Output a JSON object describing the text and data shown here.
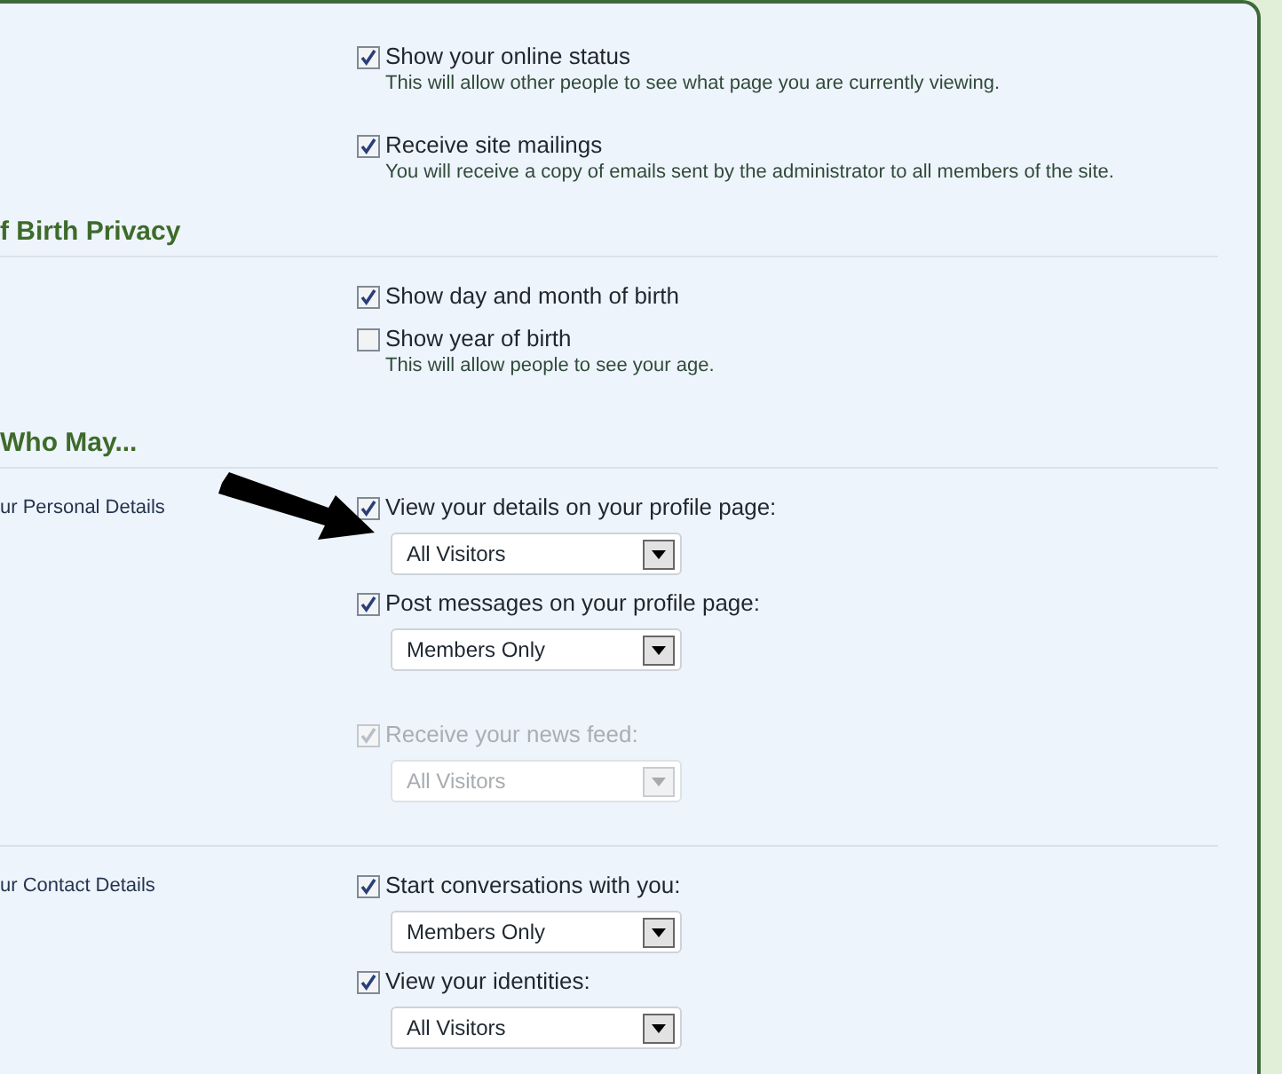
{
  "top_options": [
    {
      "label": "Show your online status",
      "checked": true,
      "description": "This will allow other people to see what page you are currently viewing."
    },
    {
      "label": "Receive site mailings",
      "checked": true,
      "description": "You will receive a copy of emails sent by the administrator to all members of the site."
    }
  ],
  "sections": [
    {
      "heading": "f Birth Privacy",
      "groups": [
        {
          "items": [
            {
              "kind": "checkbox",
              "label": "Show day and month of birth",
              "checked": true,
              "disabled": false
            },
            {
              "kind": "checkbox",
              "label": "Show year of birth",
              "checked": false,
              "disabled": false,
              "description": "This will allow people to see your age."
            }
          ]
        }
      ]
    },
    {
      "heading": "Who May...",
      "groups": [
        {
          "label": "ur Personal Details",
          "items": [
            {
              "kind": "select",
              "label": "View your details on your profile page:",
              "checked": true,
              "disabled": false,
              "value": "All Visitors"
            },
            {
              "kind": "select",
              "label": "Post messages on your profile page:",
              "checked": true,
              "disabled": false,
              "value": "Members Only"
            },
            {
              "kind": "select",
              "label": "Receive your news feed:",
              "checked": true,
              "disabled": true,
              "value": "All Visitors"
            }
          ]
        },
        {
          "label": "ur Contact Details",
          "items": [
            {
              "kind": "select",
              "label": "Start conversations with you:",
              "checked": true,
              "disabled": false,
              "value": "Members Only"
            },
            {
              "kind": "select",
              "label": "View your identities:",
              "checked": true,
              "disabled": false,
              "value": "All Visitors"
            }
          ]
        }
      ]
    }
  ]
}
